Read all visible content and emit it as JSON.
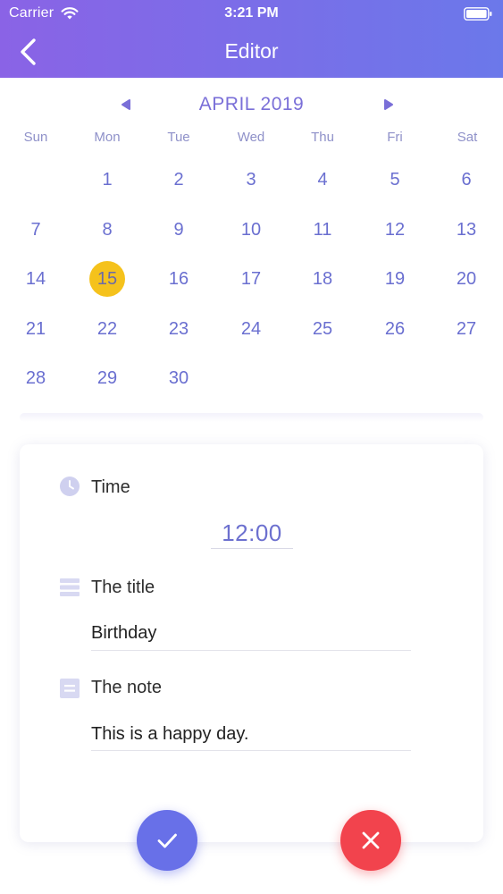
{
  "status_bar": {
    "carrier": "Carrier",
    "time": "3:21 PM",
    "icons": [
      "wifi-icon",
      "battery-icon"
    ]
  },
  "nav": {
    "title": "Editor",
    "back_icon": "chevron-left-icon"
  },
  "calendar": {
    "month_label": "APRIL 2019",
    "weekdays": [
      "Sun",
      "Mon",
      "Tue",
      "Wed",
      "Thu",
      "Fri",
      "Sat"
    ],
    "weeks": [
      [
        "",
        "1",
        "2",
        "3",
        "4",
        "5",
        "6"
      ],
      [
        "7",
        "8",
        "9",
        "10",
        "11",
        "12",
        "13"
      ],
      [
        "14",
        "15",
        "16",
        "17",
        "18",
        "19",
        "20"
      ],
      [
        "21",
        "22",
        "23",
        "24",
        "25",
        "26",
        "27"
      ],
      [
        "28",
        "29",
        "30",
        "",
        "",
        "",
        ""
      ]
    ],
    "selected_day": "15"
  },
  "editor": {
    "time_label": "Time",
    "time_value": "12:00",
    "title_label": "The title",
    "title_value": "Birthday",
    "note_label": "The note",
    "note_value": "This is a happy day."
  },
  "actions": {
    "confirm_icon": "check-icon",
    "cancel_icon": "close-icon"
  },
  "colors": {
    "header_gradient_start": "#8a63e6",
    "header_gradient_end": "#6b78ea",
    "accent": "#6c70cf",
    "selected_day": "#f5c21c",
    "confirm": "#6870e8",
    "cancel": "#f2434d"
  }
}
